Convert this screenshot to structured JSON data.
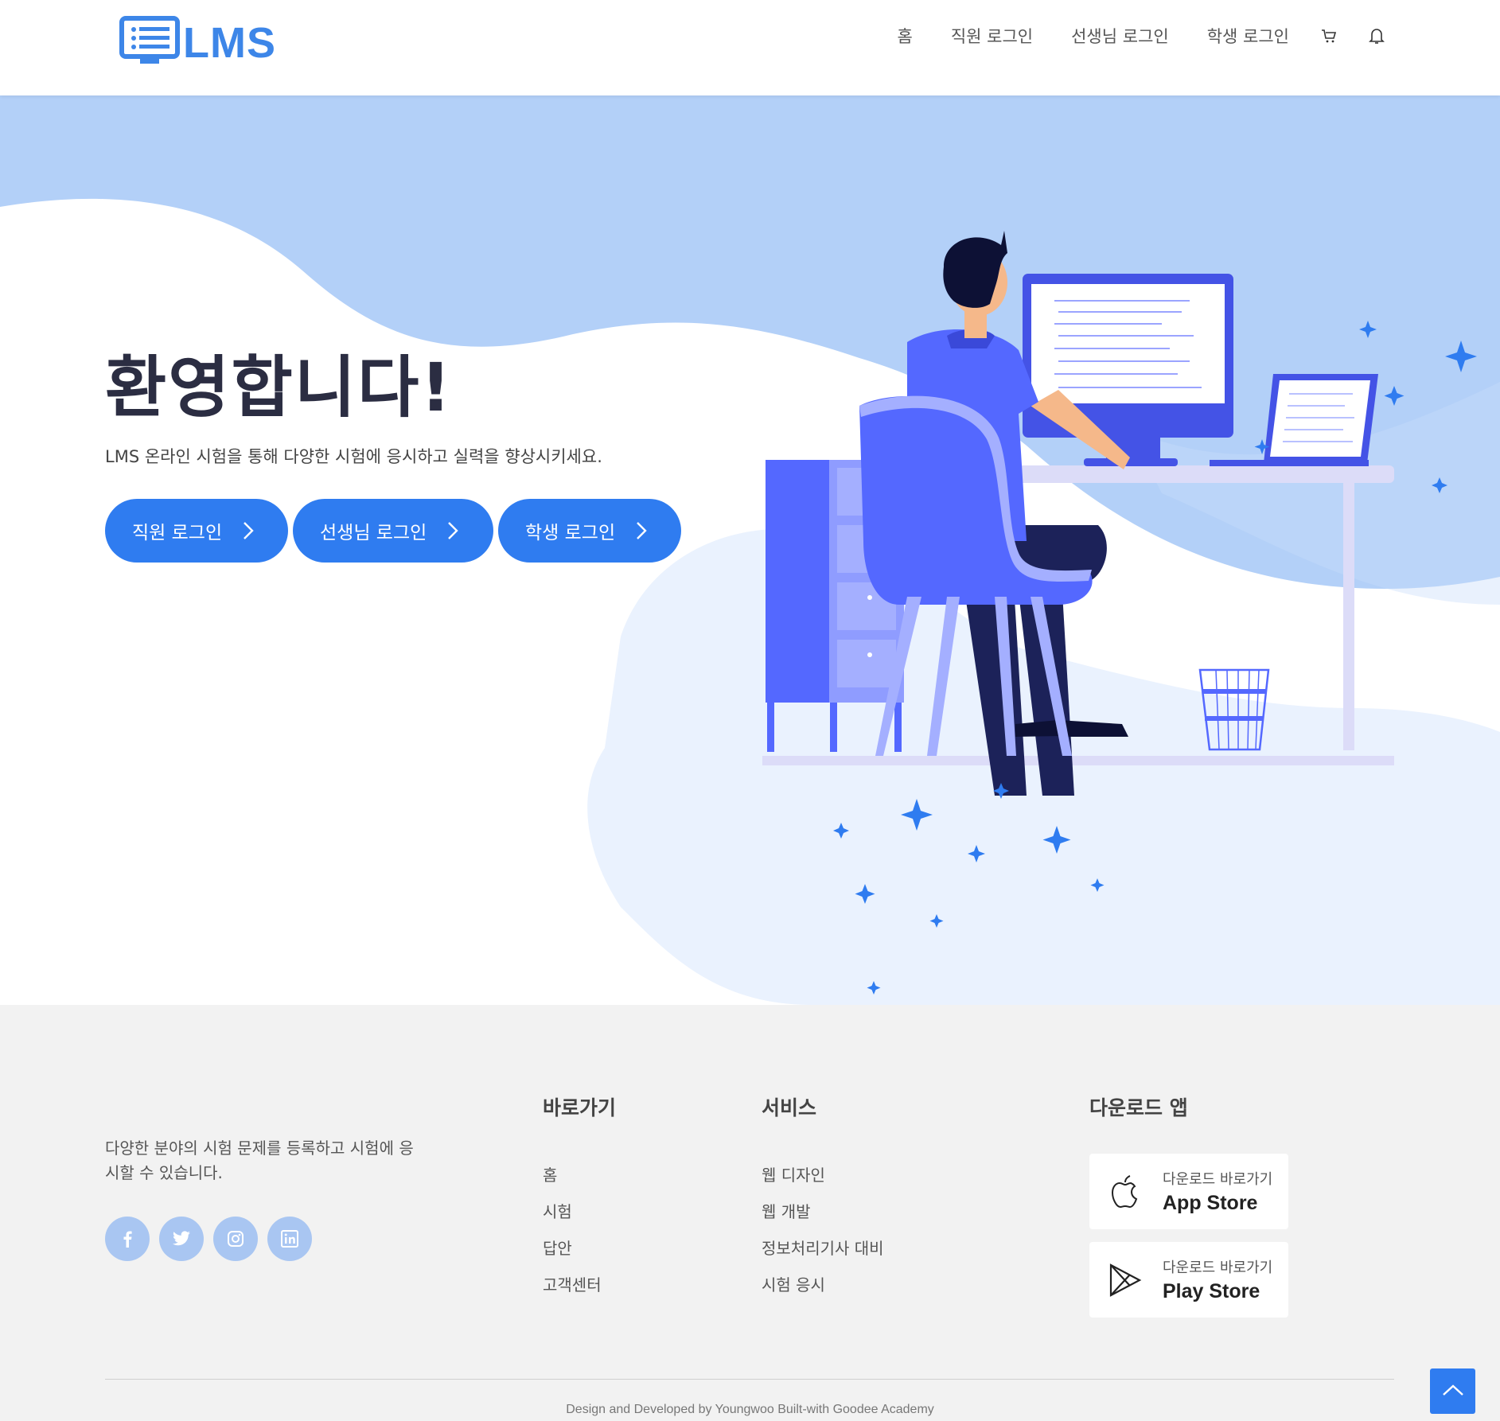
{
  "header": {
    "logo_text": "LMS",
    "nav": [
      "홈",
      "직원 로그인",
      "선생님 로그인",
      "학생 로그인"
    ],
    "icons": [
      "cart-icon",
      "bell-icon"
    ]
  },
  "hero": {
    "title": "환영합니다!",
    "subtitle": "LMS 온라인 시험을 통해 다양한 시험에 응시하고 실력을 향상시키세요.",
    "buttons": [
      "직원 로그인",
      "선생님 로그인",
      "학생 로그인"
    ]
  },
  "footer": {
    "description": "다양한 분야의 시험 문제를 등록하고 시험에 응시할 수 있습니다.",
    "socials": [
      "facebook-icon",
      "twitter-icon",
      "instagram-icon",
      "linkedin-icon"
    ],
    "quick_links": {
      "title": "바로가기",
      "items": [
        "홈",
        "시험",
        "답안",
        "고객센터"
      ]
    },
    "services": {
      "title": "서비스",
      "items": [
        "웹 디자인",
        "웹 개발",
        "정보처리기사 대비",
        "시험 응시"
      ]
    },
    "download": {
      "title": "다운로드 앱",
      "app_store": {
        "small": "다운로드 바로가기",
        "big": "App Store"
      },
      "play_store": {
        "small": "다운로드 바로가기",
        "big": "Play Store"
      }
    },
    "copyright": "Design and Developed by Youngwoo Built-with Goodee Academy"
  },
  "colors": {
    "accent": "#2f7cf0",
    "hero_blob": "#b3d0f8",
    "hero_light": "#eaf2fe",
    "illustration": "#5468ff",
    "footer_bg": "#f2f2f2"
  }
}
